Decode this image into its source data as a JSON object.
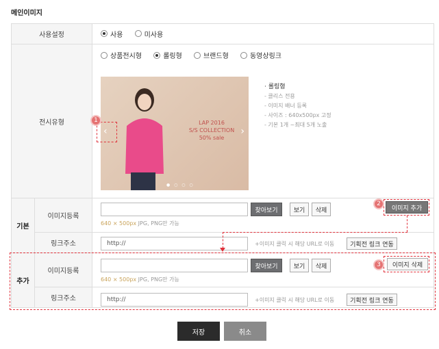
{
  "section_title": "메인이미지",
  "usage": {
    "label": "사용설정",
    "options": [
      "사용",
      "미사용"
    ],
    "selected": 0
  },
  "display_type": {
    "label": "전시유형",
    "options": [
      "상품전시형",
      "롤링형",
      "브랜드형",
      "동영상링크"
    ],
    "selected": 1,
    "banner": {
      "line1": "LAP 2016",
      "line2": "S/S COLLECTION",
      "line3": "50% sale"
    },
    "info": {
      "title": "· 롤링형",
      "lines": [
        "- 클리스 전용",
        "- 이미지 배너 등록",
        "- 사이즈 : 640x500px 고정",
        "- 기본 1개 ~최대 5개 노출"
      ]
    }
  },
  "basic": {
    "group_label": "기본",
    "image_label": "이미지등록",
    "link_label": "링크주소",
    "browse": "찾아보기",
    "view": "보기",
    "delete": "삭제",
    "add_image": "이미지 추가",
    "note_size": "640 × 500px",
    "note_rest": " JPG, PNG만 가능",
    "link_value": "http://",
    "link_hint": "+이미지 클릭 시 해당 URL로 이동",
    "link_btn": "기획전 링크 연동"
  },
  "extra": {
    "group_label": "추가",
    "image_label": "이미지등록",
    "link_label": "링크주소",
    "browse": "찾아보기",
    "view": "보기",
    "delete": "삭제",
    "remove_image": "이미지 삭제",
    "note_size": "640 × 500px",
    "note_rest": " JPG, PNG만 가능",
    "link_value": "http://",
    "link_hint": "+이미지 클릭 시 해당 URL로 이동",
    "link_btn": "기획전 링크 연동"
  },
  "badges": [
    "1",
    "2",
    "3"
  ],
  "save": "저장",
  "cancel": "취소",
  "colors": {
    "annotation": "#e0303a",
    "dark_button": "#2b2b2b",
    "accent_note": "#c9a35a"
  }
}
